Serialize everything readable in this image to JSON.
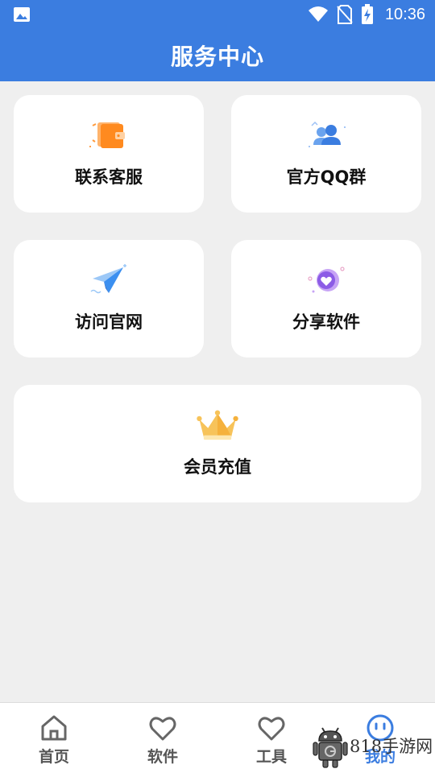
{
  "status_bar": {
    "time": "10:36",
    "left_icon": "image-icon",
    "right_icons": [
      "wifi-icon",
      "no-sim-icon",
      "battery-charging-icon"
    ]
  },
  "header": {
    "title": "服务中心",
    "background_color": "#3b7de0"
  },
  "services": [
    {
      "label": "联系客服",
      "icon": "wallet-icon"
    },
    {
      "label": "官方QQ群",
      "icon": "group-icon"
    },
    {
      "label": "访问官网",
      "icon": "paper-plane-icon"
    },
    {
      "label": "分享软件",
      "icon": "heart-share-icon"
    },
    {
      "label": "会员充值",
      "icon": "crown-icon"
    }
  ],
  "bottom_nav": {
    "items": [
      {
        "label": "首页",
        "icon": "home-icon"
      },
      {
        "label": "软件",
        "icon": "heart-icon"
      },
      {
        "label": "工具",
        "icon": "heart-icon"
      },
      {
        "label": "我的",
        "icon": "smile-face-icon",
        "active": true
      }
    ],
    "active_color": "#3b7de0"
  },
  "watermark": {
    "text": "818手游网",
    "icon": "android-robot-icon"
  }
}
